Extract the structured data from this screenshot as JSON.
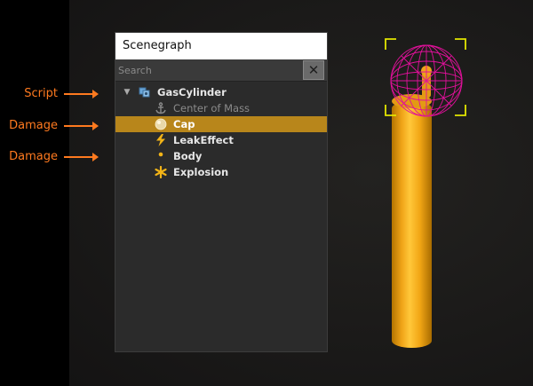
{
  "callouts": [
    {
      "label": "Script"
    },
    {
      "label": "Damage"
    },
    {
      "label": "Damage"
    }
  ],
  "panel": {
    "title": "Scenegraph",
    "search_placeholder": "Search",
    "clear_icon": "close-icon"
  },
  "tree": [
    {
      "label": "GasCylinder",
      "icon": "entity-icon",
      "expanded": true
    },
    {
      "label": "Center of Mass",
      "icon": "anchor-icon",
      "disabled": true
    },
    {
      "label": "Cap",
      "icon": "sphere-icon",
      "selected": true
    },
    {
      "label": "LeakEffect",
      "icon": "lightning-icon"
    },
    {
      "label": "Body",
      "icon": "dot-icon"
    },
    {
      "label": "Explosion",
      "icon": "burst-icon"
    }
  ],
  "colors": {
    "callout": "#ff7a1f",
    "selection": "#b8861b",
    "wireframe": "#e0109a",
    "cylinder": "#f0a418",
    "selection_bracket": "#e3e600"
  }
}
